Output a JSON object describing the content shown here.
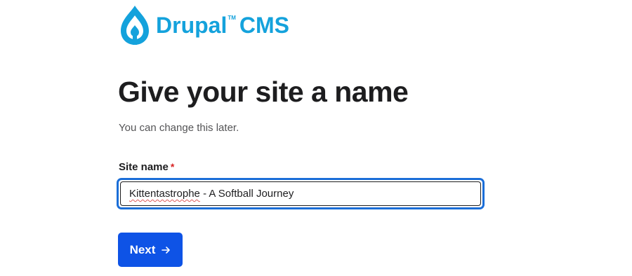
{
  "logo": {
    "brand": "Drupal",
    "tm": "TM",
    "product": "CMS",
    "icon": "drupal-drop-icon",
    "color": "#14a2dc"
  },
  "page": {
    "title": "Give your site a name",
    "subtitle": "You can change this later."
  },
  "form": {
    "site_name_label": "Site name",
    "required_marker": "*",
    "site_name_value_word1": "Kittentastrophe",
    "site_name_value_rest": " - A Softball Journey",
    "focus_color": "#1b6ed8"
  },
  "actions": {
    "next_label": "Next",
    "next_icon": "arrow-right-icon",
    "button_color": "#0e53e6"
  }
}
